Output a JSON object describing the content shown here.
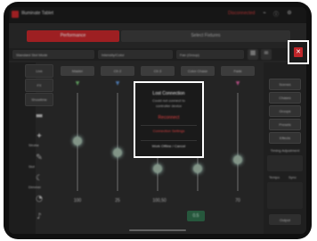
{
  "app": {
    "title": "Illuminate Tablet",
    "status_text": "Disconnected",
    "top_tabs": [
      "Performance",
      "Select Fixtures"
    ],
    "toolbar_labels": [
      "Standard Slot Mode",
      "Intensity/Color",
      "Fan (Group)"
    ],
    "sidebar_left": [
      "Live",
      "FX",
      "Showtime",
      "Stage",
      "Strobe",
      "Slot",
      "Dimmer",
      "Wheel",
      "Sound",
      "Link"
    ],
    "column_headers": [
      "Master",
      "Ch 2",
      "Ch 3",
      "Color Chase",
      "Fade"
    ],
    "column_values": [
      "100",
      "25",
      "100,50",
      "0.5",
      "70"
    ],
    "right_panel": [
      "Scenes",
      "Chases",
      "Groups",
      "Presets",
      "Effects",
      "Timing",
      "Tempo",
      "Sync"
    ],
    "right_labels": [
      "Timing Adjustment",
      "Tempo"
    ],
    "bottom_label": "Output"
  },
  "dialog": {
    "title": "Lost Connection",
    "line1": "Could not connect to",
    "line2": "controller device",
    "action_reconnect": "Reconnect",
    "action_settings": "Connection Settings",
    "action_offline": "Work Offline / Cancel"
  },
  "highlight": {
    "close_icon": "close-icon"
  },
  "colors": {
    "accent_red": "#c0262a",
    "highlight_box": "#ffffff",
    "fader_glow": "#cfeee0"
  }
}
